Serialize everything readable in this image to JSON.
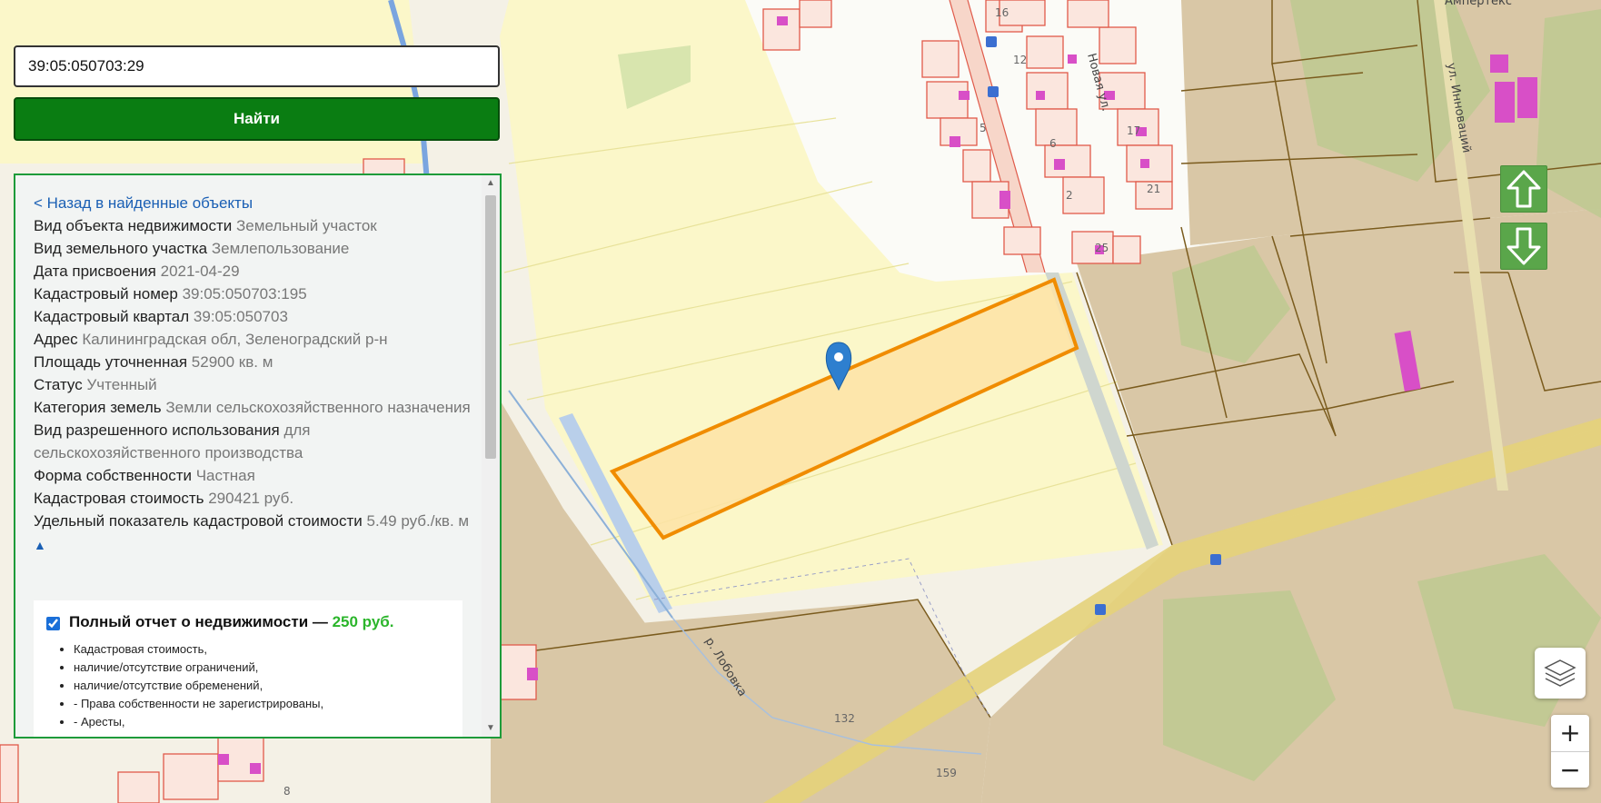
{
  "search": {
    "value": "39:05:050703:29",
    "button_label": "Найти"
  },
  "info": {
    "back_link": "< Назад в найденные объекты",
    "rows": [
      {
        "label": "Вид объекта недвижимости",
        "value": "Земельный участок"
      },
      {
        "label": "Вид земельного участка",
        "value": "Землепользование"
      },
      {
        "label": "Дата присвоения",
        "value": "2021-04-29"
      },
      {
        "label": "Кадастровый номер",
        "value": "39:05:050703:195"
      },
      {
        "label": "Кадастровый квартал",
        "value": "39:05:050703"
      },
      {
        "label": "Адрес",
        "value": "Калининградская обл, Зеленоградский р-н"
      },
      {
        "label": "Площадь уточненная",
        "value": "52900 кв. м"
      },
      {
        "label": "Статус",
        "value": "Учтенный"
      },
      {
        "label": "Категория земель",
        "value": "Земли сельскохозяйственного назначения"
      },
      {
        "label": "Вид разрешенного использования",
        "value": "для сельскохозяйственного производства"
      },
      {
        "label": "Форма собственности",
        "value": "Частная"
      },
      {
        "label": "Кадастровая стоимость",
        "value": "290421 руб."
      },
      {
        "label": "Удельный показатель кадастровой стоимости",
        "value": "5.49 руб./кв. м"
      }
    ],
    "collapse_arrow": "▲"
  },
  "report": {
    "title": "Полный отчет о недвижимости — ",
    "price": "250 руб.",
    "checked": true,
    "items": [
      "Кадастровая стоимость,",
      "наличие/отсутствие ограничений,",
      "наличие/отсутствие обременений,",
      "- Права собственности не зарегистрированы,",
      "- Аресты,"
    ]
  },
  "map": {
    "labels": {
      "street_novaya": "Новая ул.",
      "street_innovatsiy": "ул. Инноваций",
      "river": "р. Лобовка",
      "company": "Ампертекс",
      "h16": "16",
      "h12": "12",
      "h5": "5",
      "h6": "6",
      "h2": "2",
      "h25": "25",
      "h21": "21",
      "h17": "17",
      "n132": "132",
      "n159": "159",
      "n8": "8"
    }
  },
  "controls": {
    "zoom_in": "+",
    "zoom_out": "−"
  },
  "colors": {
    "accent_green": "#0a7d12",
    "parcel_outline": "#f08c00",
    "parcel_fill": "#fde3a6",
    "price_green": "#2bb52b",
    "link_blue": "#1a5fb4"
  }
}
